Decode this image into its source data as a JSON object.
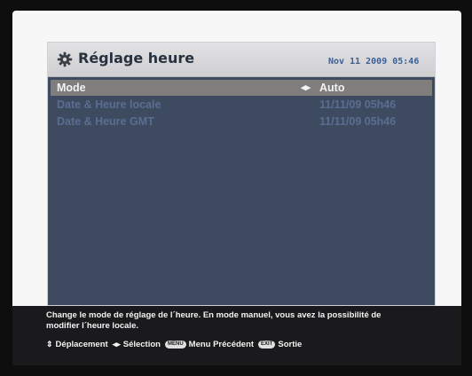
{
  "window": {
    "title": "Réglage heure",
    "title_icon": "gear-icon",
    "datetime": "Nov 11 2009 05:46"
  },
  "rows": [
    {
      "label": "Mode",
      "value": "Auto",
      "arrows": "◂▸",
      "selected": true
    },
    {
      "label": "Date & Heure locale",
      "value": "11/11/09 05h46",
      "selected": false
    },
    {
      "label": "Date & Heure GMT",
      "value": "11/11/09 05h46",
      "selected": false
    }
  ],
  "help": {
    "text": "Change le mode de réglage de l´heure. En mode manuel, vous avez la possibilité de modifier l´heure locale.",
    "legend": {
      "move_icon": "up-down-arrows-icon",
      "move_label": "Déplacement",
      "select_icon": "left-right-arrows-icon",
      "select_label": "Sélection",
      "menu_key": "MENU",
      "menu_label": "Menu Précédent",
      "exit_key": "EXIT",
      "exit_label": "Sortie"
    }
  },
  "colors": {
    "window_bg": "#3e4a60",
    "selected_row": "#7f7e7c",
    "row_text": "#5a6e92",
    "datetime_text": "#3a5f96",
    "helpbar_bg": "#1a1a1c"
  }
}
